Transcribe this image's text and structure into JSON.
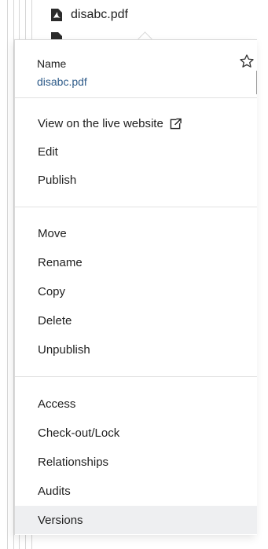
{
  "tree": {
    "file_name": "disabc.pdf",
    "file_icon": "pdf-file-icon"
  },
  "header": {
    "name_label": "Name",
    "name_value": "disabc.pdf",
    "favorite_icon": "star-outline-icon"
  },
  "groups": {
    "view": [
      {
        "label": "View on the live website",
        "icon": "external-link-icon"
      },
      {
        "label": "Edit"
      },
      {
        "label": "Publish"
      }
    ],
    "manage": [
      {
        "label": "Move"
      },
      {
        "label": "Rename"
      },
      {
        "label": "Copy"
      },
      {
        "label": "Delete"
      },
      {
        "label": "Unpublish"
      }
    ],
    "info": [
      {
        "label": "Access"
      },
      {
        "label": "Check-out/Lock"
      },
      {
        "label": "Relationships"
      },
      {
        "label": "Audits"
      },
      {
        "label": "Versions",
        "highlighted": true
      }
    ]
  },
  "colors": {
    "link_text": "#2f5c8a",
    "highlight_bg": "#eeeff1",
    "divider": "#e2e2e2"
  }
}
